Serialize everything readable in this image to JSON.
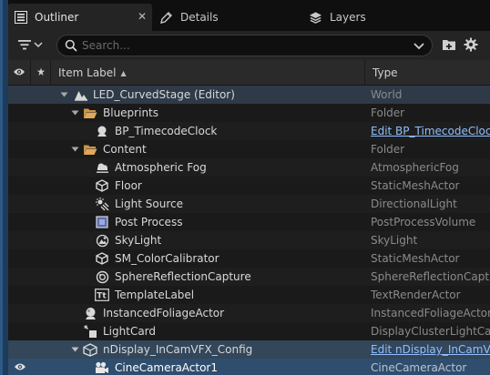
{
  "tabs": [
    {
      "label": "Outliner",
      "icon": "outliner-icon",
      "close": "✕"
    },
    {
      "label": "Details",
      "icon": "details-icon"
    },
    {
      "label": "Layers",
      "icon": "layers-icon"
    }
  ],
  "search": {
    "placeholder": "Search..."
  },
  "columns": {
    "label": "Item Label",
    "type": "Type"
  },
  "rows": [
    {
      "label": "LED_CurvedStage (Editor)",
      "type": "World",
      "icon": "world-icon",
      "expanded": true
    },
    {
      "label": "Blueprints",
      "type": "Folder",
      "icon": "folder-open-icon",
      "expanded": true
    },
    {
      "label": "BP_TimecodeClock",
      "type": "Edit BP_TimecodeClock",
      "icon": "blueprint-actor-icon"
    },
    {
      "label": "Content",
      "type": "Folder",
      "icon": "folder-open-icon",
      "expanded": true
    },
    {
      "label": "Atmospheric Fog",
      "type": "AtmosphericFog",
      "icon": "fog-icon"
    },
    {
      "label": "Floor",
      "type": "StaticMeshActor",
      "icon": "static-mesh-icon"
    },
    {
      "label": "Light Source",
      "type": "DirectionalLight",
      "icon": "directional-light-icon"
    },
    {
      "label": "Post Process",
      "type": "PostProcessVolume",
      "icon": "post-process-icon"
    },
    {
      "label": "SkyLight",
      "type": "SkyLight",
      "icon": "skylight-icon"
    },
    {
      "label": "SM_ColorCalibrator",
      "type": "StaticMeshActor",
      "icon": "static-mesh-icon"
    },
    {
      "label": "SphereReflectionCapture",
      "type": "SphereReflectionCapture",
      "icon": "reflection-capture-icon"
    },
    {
      "label": "TemplateLabel",
      "type": "TextRenderActor",
      "icon": "text-render-icon"
    },
    {
      "label": "InstancedFoliageActor",
      "type": "InstancedFoliageActor",
      "icon": "foliage-icon"
    },
    {
      "label": "LightCard",
      "type": "DisplayClusterLightCardActor",
      "icon": "lightcard-icon"
    },
    {
      "label": "nDisplay_InCamVFX_Config",
      "type": "Edit nDisplay_InCamVFX_Config",
      "icon": "ndisplay-icon",
      "expanded": true
    },
    {
      "label": "CineCameraActor1",
      "type": "CineCameraActor",
      "icon": "cine-camera-icon"
    }
  ],
  "colors": {
    "link": "#8fbfff",
    "selection": "#2f4e6e"
  }
}
